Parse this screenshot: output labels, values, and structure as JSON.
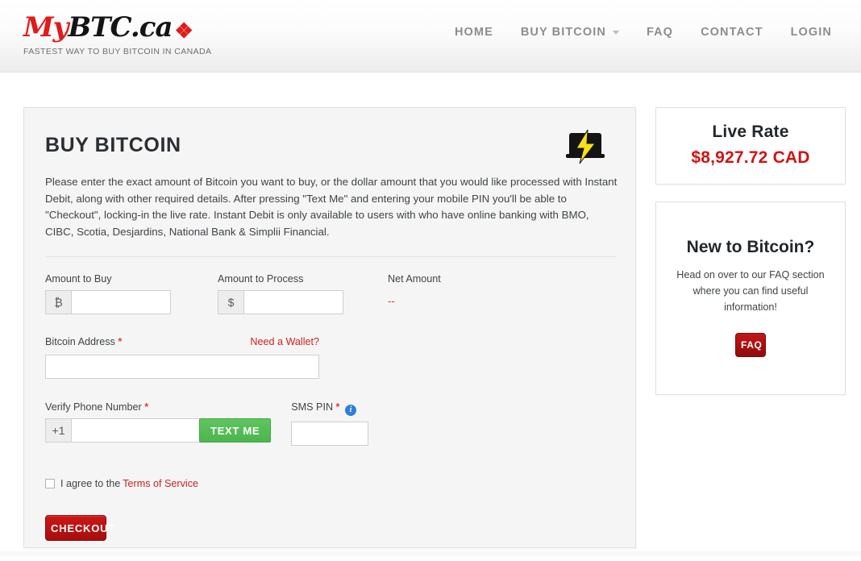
{
  "header": {
    "logo": {
      "prefix": "My",
      "suffix": "BTC.ca",
      "maple": "❖",
      "tagline": "FASTEST WAY TO BUY BITCOIN IN CANADA"
    },
    "nav": [
      {
        "label": "HOME",
        "has_caret": false
      },
      {
        "label": "BUY BITCOIN",
        "has_caret": true
      },
      {
        "label": "FAQ",
        "has_caret": false
      },
      {
        "label": "CONTACT",
        "has_caret": false
      },
      {
        "label": "LOGIN",
        "has_caret": false
      }
    ]
  },
  "main": {
    "title": "BUY BITCOIN",
    "intro": "Please enter the exact amount of Bitcoin you want to buy, or the dollar amount that you would like processed with Instant Debit, along with other required details. After pressing \"Text Me\" and entering your mobile PIN you'll be able to \"Checkout\", locking-in the live rate. Instant Debit is only available to users with who have online banking with BMO, CIBC, Scotia, Desjardins, National Bank & Simplii Financial.",
    "form": {
      "amount_to_buy": {
        "label": "Amount to Buy",
        "addon": "₿",
        "value": "",
        "placeholder": ""
      },
      "amount_to_process": {
        "label": "Amount to Process",
        "addon": "$",
        "value": "",
        "placeholder": ""
      },
      "net_amount": {
        "label": "Net Amount",
        "value": "--"
      },
      "bitcoin_address": {
        "label": "Bitcoin Address",
        "required_mark": "*",
        "value": "",
        "placeholder": "",
        "wallet_link": "Need a Wallet?"
      },
      "verify_phone": {
        "label": "Verify Phone Number",
        "required_mark": "*",
        "addon": "+1",
        "value": "",
        "placeholder": "",
        "button_label": "TEXT ME"
      },
      "sms_pin": {
        "label": "SMS PIN",
        "required_mark": "*",
        "info_glyph": "i",
        "value": "",
        "placeholder": ""
      },
      "agree": {
        "text": "I agree to the",
        "link": "Terms of Service",
        "checked": false
      },
      "checkout_label": "CHECKOUT"
    }
  },
  "sidebar": {
    "live_rate": {
      "title": "Live Rate",
      "value": "$8,927.72 CAD"
    },
    "new_to_bitcoin": {
      "title": "New to Bitcoin?",
      "text": "Head on over to our FAQ section where you can find useful information!",
      "button_label": "FAQ"
    }
  },
  "colors": {
    "brand_red": "#cf1414",
    "link_red": "#cc2222",
    "green": "#4cb54c",
    "info_blue": "#2f7fd8",
    "bolt_yellow": "#f7e017"
  }
}
